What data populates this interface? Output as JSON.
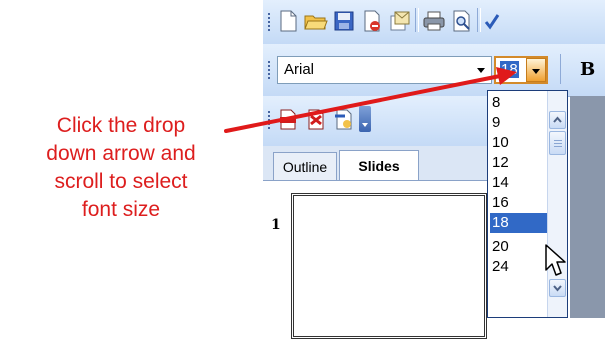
{
  "annotation": {
    "lines": [
      "Click the drop",
      "down arrow and",
      "scroll to select",
      "font size"
    ],
    "color": "#dd1e1e"
  },
  "toolbar": {
    "icons": [
      "new-document-icon",
      "open-folder-icon",
      "save-icon",
      "permission-icon",
      "email-icon",
      "print-icon",
      "print-preview-icon",
      "spelling-icon"
    ]
  },
  "formatting": {
    "font_name": "Arial",
    "font_size": "18",
    "bold_label": "B"
  },
  "secondary_toolbar": {
    "icons": [
      "pdf-create-icon",
      "pdf-email-icon",
      "pdf-review-icon",
      "toolbar-options-icon"
    ]
  },
  "tabs": [
    {
      "label": "Outline",
      "active": false
    },
    {
      "label": "Slides",
      "active": true
    }
  ],
  "slide_number": "1",
  "size_list": {
    "options": [
      "8",
      "9",
      "10",
      "12",
      "14",
      "16",
      "18",
      "20",
      "24"
    ],
    "selected": "18"
  },
  "colors": {
    "toolbar_light": "#e3effd",
    "toolbar_dark": "#c4daf6",
    "selection": "#3169c6",
    "arrow_highlight": "#f0a030"
  }
}
